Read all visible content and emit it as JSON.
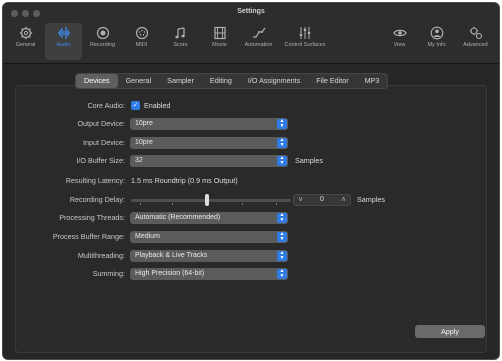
{
  "window": {
    "title": "Settings"
  },
  "toolbar": {
    "tabs": [
      {
        "label": "General",
        "icon": "gear-icon"
      },
      {
        "label": "Audio",
        "icon": "audio-waveform-icon",
        "active": true
      },
      {
        "label": "Recording",
        "icon": "record-icon"
      },
      {
        "label": "MIDI",
        "icon": "midi-icon"
      },
      {
        "label": "Score",
        "icon": "score-icon"
      },
      {
        "label": "Movie",
        "icon": "film-icon"
      },
      {
        "label": "Automation",
        "icon": "automation-icon"
      },
      {
        "label": "Control Surfaces",
        "icon": "control-surfaces-icon"
      },
      {
        "label": "View",
        "icon": "eye-icon"
      },
      {
        "label": "My Info",
        "icon": "person-icon"
      },
      {
        "label": "Advanced",
        "icon": "advanced-gears-icon"
      }
    ]
  },
  "subtabs": [
    "Devices",
    "General",
    "Sampler",
    "Editing",
    "I/O Assignments",
    "File Editor",
    "MP3"
  ],
  "subtabs_active": "Devices",
  "settings": {
    "core_audio": {
      "label": "Core Audio:",
      "checkbox_label": "Enabled",
      "checked": true
    },
    "output_device": {
      "label": "Output Device:",
      "value": "10pre"
    },
    "input_device": {
      "label": "Input Device:",
      "value": "10pre"
    },
    "io_buffer": {
      "label": "I/O Buffer Size:",
      "value": "32",
      "unit": "Samples"
    },
    "latency": {
      "label": "Resulting Latency:",
      "value": "1.5 ms Roundtrip (0.9 ms Output)"
    },
    "recording_delay": {
      "label": "Recording Delay:",
      "value": "0",
      "unit": "Samples"
    },
    "processing_threads": {
      "label": "Processing Threads:",
      "value": "Automatic (Recommended)"
    },
    "process_buffer_range": {
      "label": "Process Buffer Range:",
      "value": "Medium"
    },
    "multithreading": {
      "label": "Multithreading:",
      "value": "Playback & Live Tracks"
    },
    "summing": {
      "label": "Summing:",
      "value": "High Precision (64-bit)"
    }
  },
  "buttons": {
    "apply": "Apply"
  },
  "colors": {
    "accent": "#2f7ce6",
    "window_bg": "#262626",
    "popup_bg": "#5b5b5b"
  }
}
